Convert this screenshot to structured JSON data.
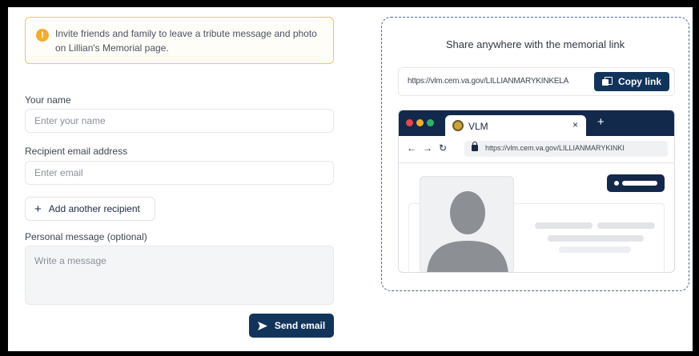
{
  "notice": {
    "icon": "info-icon",
    "line1": "Invite friends and family to leave a tribute message and photo",
    "line2": "on Lillian's Memorial page."
  },
  "form": {
    "name_label": "Your name",
    "name_placeholder": "Enter your name",
    "email_label": "Recipient email address",
    "email_placeholder": "Enter email",
    "add_recipient_label": "Add another recipient",
    "message_label": "Personal message (optional)",
    "message_placeholder": "Write a message",
    "send_label": "Send email"
  },
  "share": {
    "title": "Share anywhere with the memorial link",
    "link": "https://vlm.cem.va.gov/LILLIANMARYKINKELA",
    "copy_label": "Copy link"
  },
  "browser_preview": {
    "tab_title": "VLM",
    "tab_close": "×",
    "new_tab": "+",
    "url": "https://vlm.cem.va.gov/LILLIANMARYKINKI",
    "colors": {
      "chrome": "#13294b",
      "dot_red": "#e5484d",
      "dot_yellow": "#f2ac2f",
      "dot_green": "#2fb36a"
    }
  },
  "colors": {
    "primary": "#12345b",
    "notice_border": "#f3c467",
    "notice_icon": "#f2ac2f",
    "share_border": "#4a6a95"
  }
}
